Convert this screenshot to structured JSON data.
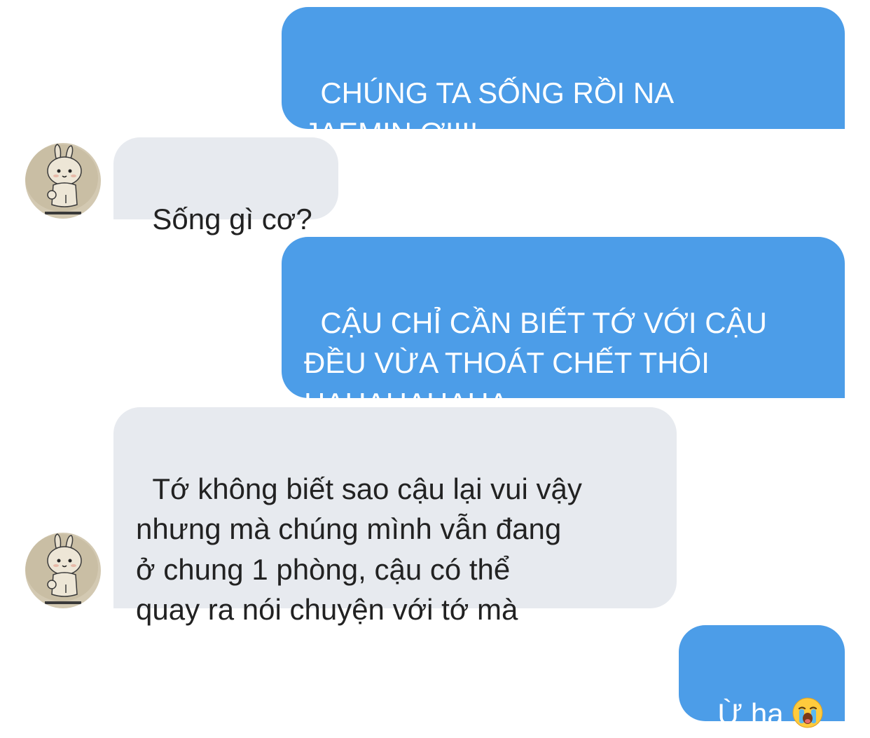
{
  "conversation": {
    "messages": [
      {
        "sender": "me",
        "text": "CHÚNG TA SỐNG RỒI NA\nJAEMIN ƠI!!!"
      },
      {
        "sender": "friend",
        "text": "Sống gì cơ?"
      },
      {
        "sender": "me",
        "text": "CẬU CHỈ CẦN BIẾT TỚ VỚI CẬU\nĐỀU VỪA THOÁT CHẾT THÔI\nHAHAHAHAHA"
      },
      {
        "sender": "friend",
        "text": "Tớ không biết sao cậu lại vui vậy\nnhưng mà chúng mình vẫn đang\nở chung 1 phòng, cậu có thể\nquay ra nói chuyện với tớ mà"
      },
      {
        "sender": "me",
        "text": "Ừ ha",
        "emoji": "loudly-crying-face-icon"
      }
    ]
  },
  "colors": {
    "sent_bubble": "#4C9DE8",
    "received_bubble": "#E7EAEF",
    "sent_text": "#FFFFFF",
    "received_text": "#222222"
  },
  "avatar": {
    "icon": "cartoon-bunny-icon"
  }
}
